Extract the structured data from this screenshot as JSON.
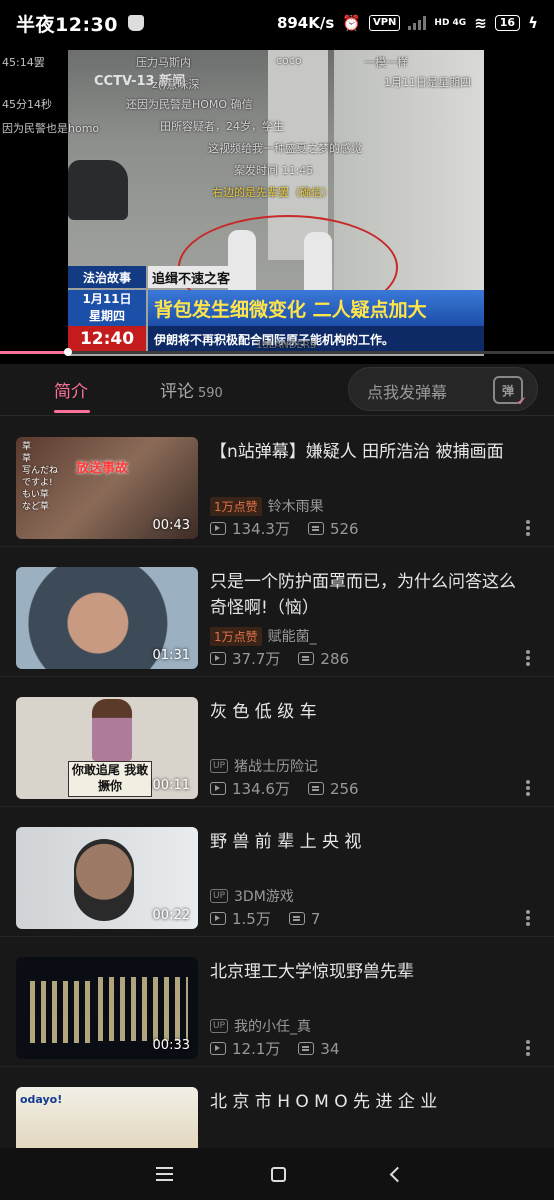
{
  "status_bar": {
    "time": "半夜12:30",
    "net_speed": "894K/s",
    "vpn": "VPN",
    "network": "HD 4G",
    "battery": "16"
  },
  "player": {
    "channel": "CCTV-13 新闻",
    "show_name": "法治故事",
    "subtitle": "追缉不速之客",
    "date_line1": "1月11日",
    "date_line2": "星期四",
    "headline": "背包发生细微变化 二人疑点加大",
    "clock": "12:40",
    "ticker": "伊朗将不再积极配合国际原子能机构的工作。",
    "danmaku": [
      "45:14罢",
      "压力马斯内",
      "45分14秒",
      "因为民警也是homo",
      "还因为民警是HOMO 确信",
      "田所容疑者，24岁，学生",
      "这视频给我一种盛夏之梦的感觉",
      "案发时间 11:45",
      "右边的是先辈罢（确信）",
      "一模一样",
      "1月11日是星期四",
      "z()意味深",
      "coco"
    ],
    "watermark": "1SLANDERS",
    "progress_percent": 12
  },
  "tabs": {
    "intro": "简介",
    "comments": "评论",
    "comments_count": "590",
    "danmaku_placeholder": "点我发弹幕",
    "danmaku_icon": "弹"
  },
  "videos": [
    {
      "title": "【n站弹幕】嫌疑人 田所浩治 被捕画面",
      "hot": "1万点赞",
      "author": "铃木雨果",
      "plays": "134.3万",
      "danmaku": "526",
      "duration": "00:43",
      "thumb_text": "放送事故"
    },
    {
      "title": "只是一个防护面罩而已，为什么问答这么奇怪啊!（恼）",
      "hot": "1万点赞",
      "author": "赋能菌_",
      "plays": "37.7万",
      "danmaku": "286",
      "duration": "01:31"
    },
    {
      "title": "灰 色 低 级 车",
      "up": "UP",
      "author": "猪战士历险记",
      "plays": "134.6万",
      "danmaku": "256",
      "duration": "00:11",
      "thumb_text": "你敢追尾 我敢撅你"
    },
    {
      "title": "野 兽 前 辈 上 央 视",
      "up": "UP",
      "author": "3DM游戏",
      "plays": "1.5万",
      "danmaku": "7",
      "duration": "00:22"
    },
    {
      "title": "北京理工大学惊现野兽先辈",
      "up": "UP",
      "author": "我的小任_真",
      "plays": "12.1万",
      "danmaku": "34",
      "duration": "00:33"
    },
    {
      "title": "北 京 市 H O M O 先 进 企 业",
      "thumb_text": "odayo!"
    }
  ],
  "colors": {
    "accent": "#fb7299",
    "background": "#181818",
    "hot_badge": "#e0724a"
  }
}
